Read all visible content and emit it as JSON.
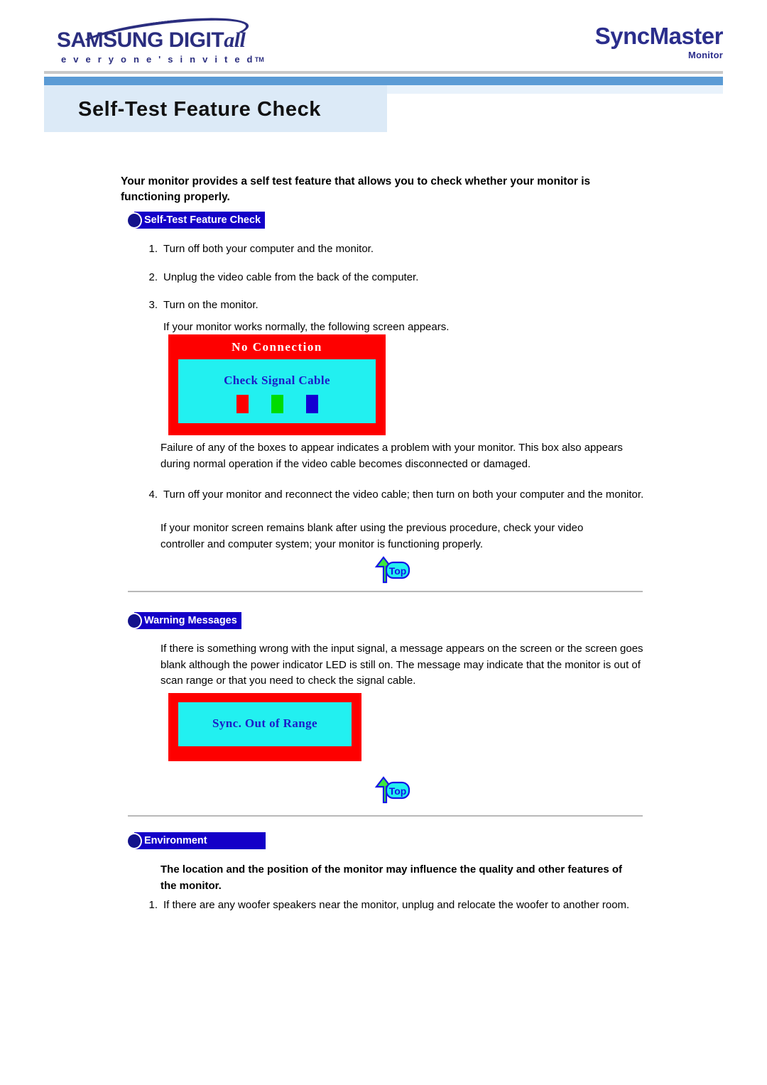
{
  "header": {
    "brand_wordmark_1": "S",
    "brand_wordmark_2": "AMSUNG DIGIT",
    "brand_wordmark_3": "all",
    "brand_tagline": "e v e r y o n e ' s   i n v i t e d",
    "brand_tagline_tm": "TM",
    "product_title": "SyncMaster",
    "product_subtitle": "Monitor",
    "brand_color": "#2B2E7F",
    "accent_color": "#5B9BD5"
  },
  "page": {
    "title": "Self-Test Feature Check",
    "title_band_color": "#DCEAF7"
  },
  "intro": {
    "text": "Your monitor provides a self test feature that allows you to check whether your monitor is functioning properly."
  },
  "sections": [
    {
      "badge": "Self-Test Feature Check",
      "steps": [
        {
          "num": "1.",
          "text": "Turn off both your computer and the monitor."
        },
        {
          "num": "2.",
          "text": "Unplug the video cable from the back of the computer."
        },
        {
          "num": "3.",
          "text": "Turn on the monitor."
        }
      ],
      "note_after_step3": "If your monitor works normally, the following screen appears.",
      "para_after_graphic": "Failure of any of the boxes to appear indicates a problem with your monitor. This box also appears during normal operation if the video cable becomes disconnected or damaged.",
      "step4": {
        "num": "4.",
        "text": "Turn off your monitor and reconnect the video cable; then turn on both your computer and the monitor."
      },
      "closing_para": "If your monitor screen remains blank after using the previous procedure, check your video controller and computer system; your monitor is functioning properly."
    },
    {
      "badge": "Warning Messages",
      "body": "If there is something wrong with the input signal, a message appears on the screen or the screen goes blank although the power indicator LED is still on. The message may indicate that the monitor is out of scan range or that you need to check the signal cable."
    },
    {
      "badge": "Environment",
      "lead": "The location and the position of the monitor may influence the quality and other features of the monitor.",
      "steps": [
        {
          "num": "1.",
          "text": "If there are any woofer speakers near the monitor, unplug and relocate the woofer to another room."
        }
      ]
    }
  ],
  "graphics": {
    "no_connection": {
      "title": "No Connection",
      "message": "Check Signal Cable",
      "outer_color": "#FE0000",
      "inner_color": "#22F0F0",
      "title_color": "#FFFFFF",
      "message_color": "#1B1BC8",
      "swatches": [
        "#FE0000",
        "#00DC00",
        "#1400D2"
      ]
    },
    "sync_out_of_range": {
      "message": "Sync. Out of Range",
      "outer_color": "#FE0000",
      "inner_color": "#22F0F0",
      "message_color": "#1B1BC8"
    }
  },
  "top_buttons": {
    "label": "Top",
    "arrow_color": "#3CE83C",
    "outline_color": "#1414E6"
  }
}
